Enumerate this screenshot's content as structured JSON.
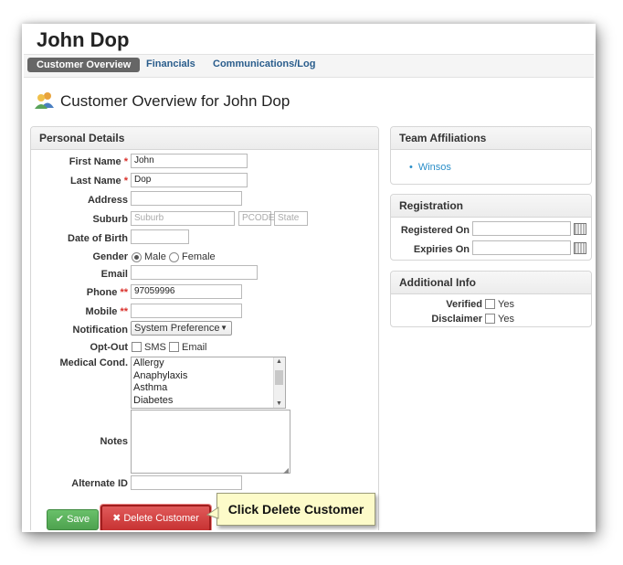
{
  "header": {
    "customer_name": "John Dop"
  },
  "tabs": [
    {
      "label": "Customer Overview",
      "active": true
    },
    {
      "label": "Financials",
      "active": false
    },
    {
      "label": "Communications/Log",
      "active": false
    }
  ],
  "overview": {
    "heading": "Customer Overview for John Dop",
    "icon": "users-icon"
  },
  "personal": {
    "title": "Personal Details",
    "labels": {
      "first_name": "First Name",
      "last_name": "Last Name",
      "address": "Address",
      "suburb": "Suburb",
      "dob": "Date of Birth",
      "gender": "Gender",
      "email": "Email",
      "phone": "Phone",
      "mobile": "Mobile",
      "notification": "Notification",
      "opt_out": "Opt-Out",
      "medical": "Medical Cond.",
      "notes": "Notes",
      "alternate_id": "Alternate ID"
    },
    "required_marker": "*",
    "double_required_marker": "**",
    "values": {
      "first_name": "John",
      "last_name": "Dop",
      "address": "",
      "phone": "97059996"
    },
    "placeholders": {
      "suburb": "Suburb",
      "postcode": "PCODE",
      "state": "State"
    },
    "gender_options": {
      "male": "Male",
      "female": "Female",
      "selected": "Male"
    },
    "notification_value": "System Preference",
    "opt_out_options": {
      "sms": "SMS",
      "email": "Email"
    },
    "medical_conditions": [
      "Allergy",
      "Anaphylaxis",
      "Asthma",
      "Diabetes"
    ]
  },
  "actions": {
    "save_label": "Save",
    "delete_label": "Delete Customer"
  },
  "callout": {
    "text": "Click Delete Customer"
  },
  "team": {
    "title": "Team Affiliations",
    "items": [
      "Winsos"
    ]
  },
  "registration": {
    "title": "Registration",
    "registered_on_label": "Registered On",
    "expiries_on_label": "Expiries On"
  },
  "additional": {
    "title": "Additional Info",
    "verified_label": "Verified",
    "disclaimer_label": "Disclaimer",
    "yes_label": "Yes"
  },
  "colors": {
    "accent": "#2a5d8c",
    "save": "#4ea24f",
    "delete": "#c73232",
    "callout": "#fdfbc9"
  }
}
